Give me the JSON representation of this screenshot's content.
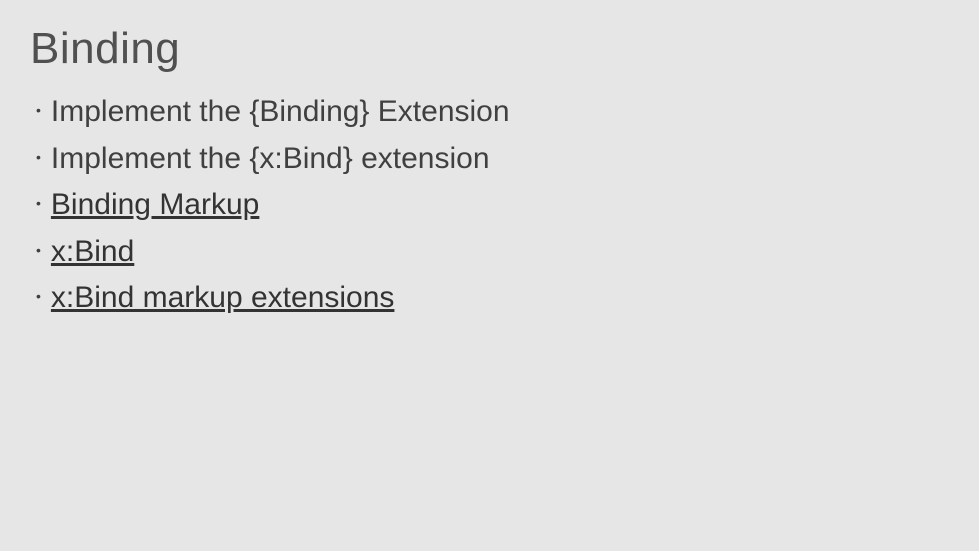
{
  "title": "Binding",
  "items": [
    {
      "text": "Implement the {Binding} Extension",
      "link": false
    },
    {
      "text": "Implement the {x:Bind} extension",
      "link": false
    },
    {
      "text": "Binding Markup",
      "link": true
    },
    {
      "text": "x:Bind",
      "link": true
    },
    {
      "text": "x:Bind markup extensions",
      "link": true
    }
  ]
}
